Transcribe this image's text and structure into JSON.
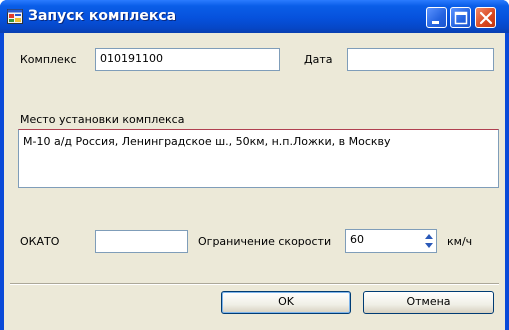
{
  "window": {
    "title": "Запуск комплекса"
  },
  "form": {
    "complex_label": "Комплекс",
    "complex_value": "010191100",
    "date_label": "Дата",
    "date_value": "",
    "location_label": "Место установки комплекса",
    "location_value": "М-10 а/д Россия, Ленинградское ш., 50км,  н.п.Ложки, в Москву",
    "okato_label": "ОКАТО",
    "okato_value": "",
    "speed_label": "Ограничение скорости",
    "speed_value": "60",
    "speed_unit": "км/ч"
  },
  "buttons": {
    "ok": "OK",
    "cancel": "Отмена"
  },
  "colors": {
    "title_bar": "#0651dc",
    "dialog_bg": "#ece9d8",
    "close_button": "#d9471f",
    "input_border": "#7f9db9"
  },
  "icons": [
    "app-icon",
    "minimize-icon",
    "maximize-icon",
    "close-icon",
    "spin-arrows-icon"
  ]
}
